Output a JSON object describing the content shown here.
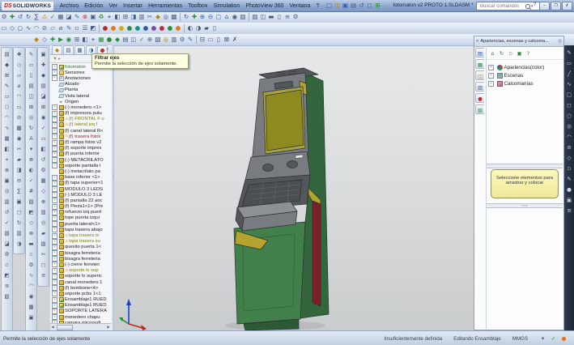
{
  "window": {
    "title": "fotomaton v2 PROTO 1.SLDASM *"
  },
  "menubar": {
    "logo_ds": "DS",
    "logo_text": "SOLIDWORKS",
    "menus": [
      "Archivo",
      "Edición",
      "Ver",
      "Insertar",
      "Herramientas",
      "Toolbox",
      "Simulation",
      "PhotoView 360",
      "Ventana",
      "?"
    ],
    "window_buttons": [
      "–",
      "❐",
      "✗"
    ],
    "help_label": "?"
  },
  "search": {
    "placeholder": "Buscar comandos"
  },
  "quick_access": [
    {
      "g": "▢",
      "c": "blu",
      "n": "new-document-icon"
    },
    {
      "g": "◫",
      "c": "amb",
      "n": "open-document-icon"
    },
    {
      "g": "▣",
      "c": "blu",
      "n": "save-icon"
    },
    {
      "g": "▤",
      "c": "sl",
      "n": "print-icon"
    },
    {
      "g": "↺",
      "c": "blu",
      "n": "undo-icon"
    },
    {
      "g": "◻",
      "c": "sl",
      "n": "select-icon"
    },
    {
      "g": "⊞",
      "c": "grn",
      "n": "rebuild-icon"
    }
  ],
  "toolbars": {
    "row2": [
      {
        "g": "⚙",
        "c": "sl"
      },
      {
        "g": "✚",
        "c": "grn"
      },
      {
        "g": "↺",
        "c": "blu"
      },
      {
        "g": "↻",
        "c": "blu"
      },
      {
        "g": "∑",
        "c": "sl"
      },
      {
        "g": "⚠",
        "c": "amb"
      },
      {
        "g": "✓",
        "c": "grn"
      },
      {
        "g": "▦",
        "c": "sl"
      },
      {
        "g": "◪",
        "c": "sl"
      },
      {
        "g": "✎",
        "c": "blu"
      },
      {
        "g": "⊗",
        "c": "red"
      },
      {
        "g": "▣",
        "c": "sl"
      },
      {
        "g": "♻",
        "c": "grn"
      },
      {
        "g": "⌖",
        "c": "sl"
      },
      {
        "g": "◧",
        "c": "sl"
      },
      {
        "g": "⊞",
        "c": "sl"
      },
      {
        "g": "◨",
        "c": "blu"
      },
      {
        "g": "▥",
        "c": "sl"
      },
      {
        "g": "✂",
        "c": "sl"
      },
      {
        "g": "◆",
        "c": "amb"
      },
      {
        "g": "◎",
        "c": "sl"
      },
      {
        "g": "▩",
        "c": "sl"
      },
      {
        "c": "sep"
      },
      {
        "g": "↻",
        "c": "blu"
      },
      {
        "g": "✚",
        "c": "grn"
      },
      {
        "g": "⊕",
        "c": "blu"
      },
      {
        "g": "⊖",
        "c": "blu"
      },
      {
        "g": "◻",
        "c": "blu"
      },
      {
        "g": "⌂",
        "c": "blu"
      },
      {
        "g": "◉",
        "c": "sl"
      },
      {
        "g": "▧",
        "c": "sl"
      },
      {
        "c": "sep"
      },
      {
        "g": "▨",
        "c": "sl"
      },
      {
        "g": "◫",
        "c": "sl"
      },
      {
        "g": "▬",
        "c": "sl"
      },
      {
        "g": "▯",
        "c": "sl"
      },
      {
        "g": "≡",
        "c": "sl"
      },
      {
        "g": "⚙",
        "c": "sl"
      }
    ],
    "row3": [
      {
        "g": "▭",
        "c": "sl"
      },
      {
        "g": "◇",
        "c": "sl"
      },
      {
        "g": "○",
        "c": "sl"
      },
      {
        "g": "∿",
        "c": "sl"
      },
      {
        "g": "◠",
        "c": "sl"
      },
      {
        "g": "⊘",
        "c": "sl"
      },
      {
        "g": "▱",
        "c": "sl"
      },
      {
        "g": "⌀",
        "c": "sl"
      },
      {
        "g": "✎",
        "c": "blu"
      },
      {
        "g": "▫",
        "c": "sl"
      },
      {
        "g": "☰",
        "c": "sl"
      },
      {
        "g": "◩",
        "c": "sl"
      },
      {
        "c": "sep"
      },
      {
        "g": "●",
        "c": "red"
      },
      {
        "g": "●",
        "c": "org"
      },
      {
        "g": "●",
        "c": "yel"
      },
      {
        "g": "●",
        "c": "grn"
      },
      {
        "g": "●",
        "c": "tea"
      },
      {
        "g": "●",
        "c": "blu"
      },
      {
        "g": "●",
        "c": "pur"
      },
      {
        "g": "●",
        "c": "red"
      },
      {
        "g": "●",
        "c": "grn"
      },
      {
        "g": "●",
        "c": "org"
      },
      {
        "c": "sep"
      },
      {
        "g": "◐",
        "c": "sl"
      },
      {
        "g": "◑",
        "c": "sl"
      },
      {
        "g": "▰",
        "c": "sl"
      },
      {
        "g": "▯",
        "c": "sl"
      }
    ],
    "row4": [
      {
        "g": "◆",
        "c": "amb"
      },
      {
        "g": "◇",
        "c": "sl"
      },
      {
        "g": "✚",
        "c": "grn"
      },
      {
        "g": "▶",
        "c": "grn"
      },
      {
        "g": "◉",
        "c": "grn"
      },
      {
        "g": "⊞",
        "c": "sl"
      },
      {
        "g": "◧",
        "c": "sl"
      },
      {
        "g": "⌖",
        "c": "sl"
      },
      {
        "g": "▦",
        "c": "grn"
      },
      {
        "g": "●",
        "c": "grn"
      },
      {
        "g": "◆",
        "c": "grn"
      },
      {
        "g": "▤",
        "c": "sl"
      },
      {
        "g": "◫",
        "c": "sl"
      },
      {
        "g": "✓",
        "c": "grn"
      },
      {
        "g": "⊕",
        "c": "sl"
      },
      {
        "g": "▧",
        "c": "sl"
      },
      {
        "g": "◎",
        "c": "amb"
      },
      {
        "g": "▥",
        "c": "sl"
      },
      {
        "g": "⚙",
        "c": "sl"
      },
      {
        "g": "✎",
        "c": "blu"
      },
      {
        "c": "sep"
      },
      {
        "g": "⊟",
        "c": "sl"
      },
      {
        "g": "▭",
        "c": "sl"
      },
      {
        "g": "▯",
        "c": "sl"
      },
      {
        "g": "⊠",
        "c": "sl"
      },
      {
        "g": "✗",
        "c": "sl"
      }
    ],
    "col1": [
      "▤",
      "◆",
      "⊞",
      "✎",
      "▭",
      "○",
      "◠",
      "∿",
      "▦",
      "◧",
      "⌖",
      "⊕",
      "▣",
      "◎",
      "▥",
      "↺",
      "✓",
      "▧",
      "◪",
      "⚙",
      "▫",
      "◩",
      "≡",
      "▨"
    ],
    "col2": [
      "✚",
      "◇",
      "▱",
      "⌀",
      "◠",
      "▭",
      "⊘",
      "▩",
      "◉",
      "✂",
      "▰",
      "◨",
      "⊖",
      "∑",
      "▣",
      "◻",
      "↻",
      "▥",
      "◑"
    ],
    "col3": [
      "✎",
      "▭",
      "▯",
      "▤",
      "◫",
      "⊞",
      "◎",
      "↻",
      "A",
      "▾",
      "⊕",
      "◐",
      "✓",
      "#",
      "▨",
      "◩",
      "◇",
      "⊗",
      "▬",
      "▫",
      "⚙",
      "∿",
      "◠",
      "◉",
      "▦",
      "▣"
    ],
    "col4": [
      "▣",
      "✚",
      "◆",
      "▤",
      "◪",
      "⊞",
      "◉",
      "✓",
      "▭",
      "◧",
      "↺",
      "⚙",
      "▦",
      "◇",
      "⊕",
      "▥",
      "◎",
      "▰",
      "▧",
      "✂",
      "◻",
      "≡"
    ],
    "right_col": [
      "✎",
      "▭",
      "╱",
      "∿",
      "▢",
      "◻",
      "○",
      "◎",
      "◠",
      "⊘",
      "◇",
      "▫",
      "✎",
      "●",
      "▣",
      "≡"
    ]
  },
  "fm": {
    "tabs": [
      {
        "g": "◆",
        "c": "amb",
        "n": "tab-featuremanager"
      },
      {
        "g": "▤",
        "c": "sl",
        "n": "tab-propertymanager"
      },
      {
        "g": "▦",
        "c": "sl",
        "n": "tab-configurationmanager"
      },
      {
        "g": "◑",
        "c": "blu",
        "n": "tab-displaymanager"
      },
      {
        "g": "●",
        "c": "red",
        "n": "tab-dimxpertmanager"
      }
    ],
    "more_label": "»",
    "filter_glyph": "▼",
    "items": [
      {
        "l": "fotomaton",
        "t": "asm",
        "c": "grn",
        "e": "e"
      },
      {
        "l": "Sensores",
        "t": "fold",
        "e": "e"
      },
      {
        "l": "Anotaciones",
        "t": "note",
        "e": "e"
      },
      {
        "l": "Alzado",
        "t": "plane"
      },
      {
        "l": "Planta",
        "t": "plane"
      },
      {
        "l": "Vista lateral",
        "t": "plane"
      },
      {
        "l": "Origen",
        "t": "orig"
      },
      {
        "l": "(-) monedero <1>",
        "t": "part",
        "e": "e"
      },
      {
        "l": "(f) impresora putu",
        "t": "part",
        "e": "e"
      },
      {
        "l": "(f) FRONTAL F u",
        "t": "part",
        "e": "e",
        "w": "w",
        "c": "olv"
      },
      {
        "l": "(f) lateral izq f",
        "t": "part",
        "e": "e",
        "w": "w",
        "c": "olv"
      },
      {
        "l": "(f) canal lateral R<",
        "t": "part",
        "e": "e"
      },
      {
        "l": "(f) trasera fotos",
        "t": "part",
        "e": "e",
        "w": "w",
        "c": "red"
      },
      {
        "l": "(f) rampa fotos v2",
        "t": "part",
        "e": "e"
      },
      {
        "l": "(f) soporte impres",
        "t": "part",
        "e": "e"
      },
      {
        "l": "(f) puerta inferior",
        "t": "part",
        "e": "e"
      },
      {
        "l": "(-) METACRILATO",
        "t": "part",
        "e": "e"
      },
      {
        "l": "soporte pantalla t",
        "t": "part",
        "e": "e"
      },
      {
        "l": "(-) metacrilato pa",
        "t": "part"
      },
      {
        "l": "base inferior <1>",
        "t": "part",
        "e": "e"
      },
      {
        "l": "(f) tapa superior<1",
        "t": "part",
        "e": "e"
      },
      {
        "l": "MODULO 3 LEDS",
        "t": "part",
        "e": "e"
      },
      {
        "l": "(-) MODULO 3 LE",
        "t": "part",
        "e": "e"
      },
      {
        "l": "(f) pantalla 22 aoc",
        "t": "part",
        "e": "e"
      },
      {
        "l": "(f) Pieza1<1> (Pre",
        "t": "part",
        "e": "e"
      },
      {
        "l": "refuerzo izq puert",
        "t": "part",
        "e": "e"
      },
      {
        "l": "tope puerta izqui",
        "t": "part",
        "e": "e"
      },
      {
        "l": "puerta lateral<1>",
        "t": "part",
        "e": "e"
      },
      {
        "l": "tapa trasera abajo",
        "t": "part",
        "e": "e"
      },
      {
        "l": "tapa trasera m",
        "t": "part",
        "e": "e",
        "w": "w",
        "c": "olv"
      },
      {
        "l": "tapa trasera su",
        "t": "part",
        "e": "e",
        "w": "w",
        "c": "olv"
      },
      {
        "l": "quesito puerta 1<",
        "t": "part",
        "e": "e"
      },
      {
        "l": "bisagra ferreteria",
        "t": "part",
        "e": "e"
      },
      {
        "l": "bisagra ferreteria",
        "t": "part",
        "e": "e"
      },
      {
        "l": "(-) cierre ferreteri",
        "t": "part",
        "e": "e"
      },
      {
        "l": "soporte tv sup",
        "t": "part",
        "e": "e",
        "w": "w",
        "c": "olv"
      },
      {
        "l": "soporte tv superic",
        "t": "part",
        "e": "e"
      },
      {
        "l": "canal monedero 1",
        "t": "part",
        "e": "e"
      },
      {
        "l": "(f) bombone<4>",
        "t": "part",
        "e": "e"
      },
      {
        "l": "soporte pcbs 1<1",
        "t": "part",
        "e": "e"
      },
      {
        "l": "Ensamblaje1 RUED",
        "t": "asm",
        "e": "e"
      },
      {
        "l": "Ensamblaje1 RUED",
        "t": "asm",
        "e": "e"
      },
      {
        "l": "SOPORTE LATERA",
        "t": "part",
        "e": "e"
      },
      {
        "l": "monedero chapu",
        "t": "part",
        "e": "e"
      },
      {
        "l": "camara microsoft",
        "t": "part",
        "e": "e"
      }
    ]
  },
  "tooltip": {
    "title": "Filtrar ejes",
    "body": "Permite la selección de ejes solamente."
  },
  "taskpane": {
    "header": "Apariencias, escenas y calcoma...",
    "chevron": "«",
    "pin": "◎",
    "tabs": [
      {
        "g": "▤",
        "c": "blu",
        "n": "tab-solidworks-resources"
      },
      {
        "g": "▦",
        "c": "grn",
        "n": "tab-design-library"
      },
      {
        "g": "◫",
        "c": "amb",
        "n": "tab-file-explorer"
      },
      {
        "g": "▥",
        "c": "sl",
        "n": "tab-view-palette"
      },
      {
        "g": "●",
        "c": "red",
        "n": "tab-appearances-scenes"
      },
      {
        "g": "▧",
        "c": "grn",
        "n": "tab-custom-properties"
      }
    ],
    "toolbar": [
      {
        "g": "⌂",
        "c": "sl",
        "n": "home-icon"
      },
      {
        "g": "↻",
        "c": "sl",
        "n": "refresh-icon"
      },
      {
        "g": "▫",
        "c": "sl",
        "n": "options-icon"
      },
      {
        "g": "▣",
        "c": "grn",
        "n": "apply-icon"
      },
      {
        "g": "?",
        "c": "sl",
        "n": "help-icon"
      }
    ],
    "tree": [
      {
        "l": "Apariencias(color)",
        "t": "pie",
        "e": "e"
      },
      {
        "l": "Escenas",
        "t": "scene",
        "e": "e"
      },
      {
        "l": "Calcomanías",
        "t": "decal",
        "e": "e"
      }
    ],
    "message": "Seleccione elementos para arrastrar y colocar",
    "splitter_dots": "▪ ▪ ▪"
  },
  "statusbar": {
    "left": "Permite la selección de ejes solamente",
    "defined": "Insuficientemente definida",
    "mode": "Editando Ensamblaje",
    "units": "MMGS",
    "icons": [
      {
        "g": "▾",
        "c": "sl",
        "n": "units-dropdown-icon"
      },
      {
        "g": "✓",
        "c": "grn",
        "n": "tag-icon"
      },
      {
        "g": "●",
        "c": "org",
        "n": "quick-tip-icon"
      }
    ]
  },
  "model_colors": {
    "green": "#41804a",
    "green_dark": "#33663c",
    "green_base": "#2c5a34",
    "gray": "#787b80",
    "gray_light": "#8d9095",
    "gray_dark": "#53565a",
    "screen": "#8e8a1f",
    "screen_rim": "#a6a242",
    "red": "#7c1f26",
    "yellow": "#b2a42c",
    "keys": "#4c4f52"
  }
}
